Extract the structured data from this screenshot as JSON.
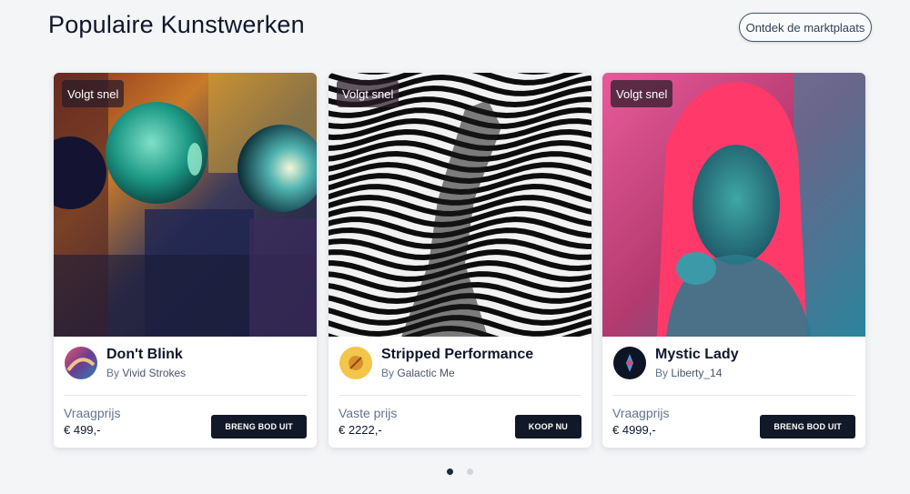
{
  "header": {
    "title": "Populaire Kunstwerken",
    "explore_label": "Ontdek de marktplaats"
  },
  "cards": [
    {
      "badge": "Volgt snel",
      "title": "Don't Blink",
      "by": "By",
      "artist": "Vivid Strokes",
      "price_label": "Vraagprijs",
      "price": "€ 499,-",
      "action": "BRENG BOD UIT"
    },
    {
      "badge": "Volgt snel",
      "title": "Stripped Performance",
      "by": "By",
      "artist": "Galactic Me",
      "price_label": "Vaste prijs",
      "price": "€ 2222,-",
      "action": "KOOP NU"
    },
    {
      "badge": "Volgt snel",
      "title": "Mystic Lady",
      "by": "By",
      "artist": "Liberty_14",
      "price_label": "Vraagprijs",
      "price": "€ 4999,-",
      "action": "BRENG BOD UIT"
    }
  ],
  "pagination": {
    "pages": 2,
    "current": 1
  },
  "colors": {
    "accent": "#111827",
    "muted": "#64748b",
    "background": "#f4f5f7"
  }
}
